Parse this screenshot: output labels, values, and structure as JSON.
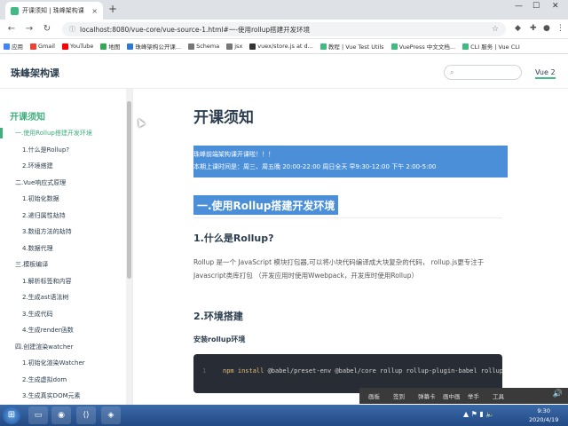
{
  "browser": {
    "tab_title": "开课须知 | 珠峰架构课",
    "tab_close": "×",
    "new_tab": "+",
    "win_min": "—",
    "win_max": "☐",
    "win_close": "✕",
    "back": "←",
    "forward": "→",
    "reload": "↻",
    "url": "localhost:8080/vue-core/vue-source-1.html#一-使用rollup搭建开发环境",
    "bookmarks": [
      {
        "label": "应用",
        "color": "#4285f4"
      },
      {
        "label": "Gmail",
        "color": "#ea4335"
      },
      {
        "label": "YouTube",
        "color": "#ff0000"
      },
      {
        "label": "地图",
        "color": "#34a853"
      },
      {
        "label": "珠峰架构公开课...",
        "color": "#2c7ad6"
      },
      {
        "label": "Schema",
        "color": "#777777"
      },
      {
        "label": "jsx",
        "color": "#777777"
      },
      {
        "label": "vuex/store.js at d...",
        "color": "#333333"
      },
      {
        "label": "教程 | Vue Test Utils",
        "color": "#42b983"
      },
      {
        "label": "VuePress 中文文档...",
        "color": "#42b983"
      },
      {
        "label": "CLI 服务 | Vue CLI",
        "color": "#42b983"
      }
    ]
  },
  "site": {
    "title": "珠峰架构课",
    "nav_link": "Vue 2"
  },
  "sidebar": {
    "group": "开课须知",
    "items": [
      {
        "label": "一.使用Rollup搭建开发环境",
        "level": 1,
        "active": true
      },
      {
        "label": "1.什么是Rollup?",
        "level": 2,
        "active": false
      },
      {
        "label": "2.环境搭建",
        "level": 2,
        "active": false
      },
      {
        "label": "二.Vue响应式原理",
        "level": 1,
        "active": false
      },
      {
        "label": "1.初始化数据",
        "level": 2,
        "active": false
      },
      {
        "label": "2.递归属性劫持",
        "level": 2,
        "active": false
      },
      {
        "label": "3.数组方法的劫持",
        "level": 2,
        "active": false
      },
      {
        "label": "4.数据代理",
        "level": 2,
        "active": false
      },
      {
        "label": "三.模板编译",
        "level": 1,
        "active": false
      },
      {
        "label": "1.解析标签和内容",
        "level": 2,
        "active": false
      },
      {
        "label": "2.生成ast语法树",
        "level": 2,
        "active": false
      },
      {
        "label": "3.生成代码",
        "level": 2,
        "active": false
      },
      {
        "label": "4.生成render函数",
        "level": 2,
        "active": false
      },
      {
        "label": "四.创建渲染watcher",
        "level": 1,
        "active": false
      },
      {
        "label": "1.初始化渲染Watcher",
        "level": 2,
        "active": false
      },
      {
        "label": "2.生成虚拟dom",
        "level": 2,
        "active": false
      },
      {
        "label": "3.生成真实DOM元素",
        "level": 2,
        "active": false
      },
      {
        "label": "五.生命周期的合并",
        "level": 1,
        "active": false
      }
    ]
  },
  "content": {
    "title": "开课须知",
    "notice_lines": [
      "珠峰前端架构课开课啦！！！",
      "本期上课时间是：周三、周五晚 20:00-22:00 周日全天 早9:30-12:00 下午 2:00-5:00"
    ],
    "section_heading": "一.使用Rollup搭建开发环境",
    "h3_1": "1.什么是Rollup?",
    "paragraph_1": "Rollup 是一个 JavaScript 模块打包器,可以将小块代码编译成大块复杂的代码， rollup.js更专注于Javascript类库打包 （开发应用时使用Wwebpack，开发库时使用Rollup）",
    "h3_2": "2.环境搭建",
    "install_label": "安装rollup环境",
    "code_line_number": "1",
    "code_cmd_keyword": "npm install",
    "code_cmd_rest": " @babel/preset-env @babel/core rollup rollup-plugin-babel rollup-plugin-serve cross-env -D"
  },
  "player": {
    "buttons": [
      "画板",
      "签到",
      "弹幕卡",
      "画中画",
      "举手",
      "工具"
    ],
    "volume": "🔊"
  },
  "taskbar": {
    "start": "⊞",
    "clock_time": "9:30",
    "clock_date": "2020/4/19",
    "tray": "▲ ⚑ ▮ 🔈"
  }
}
